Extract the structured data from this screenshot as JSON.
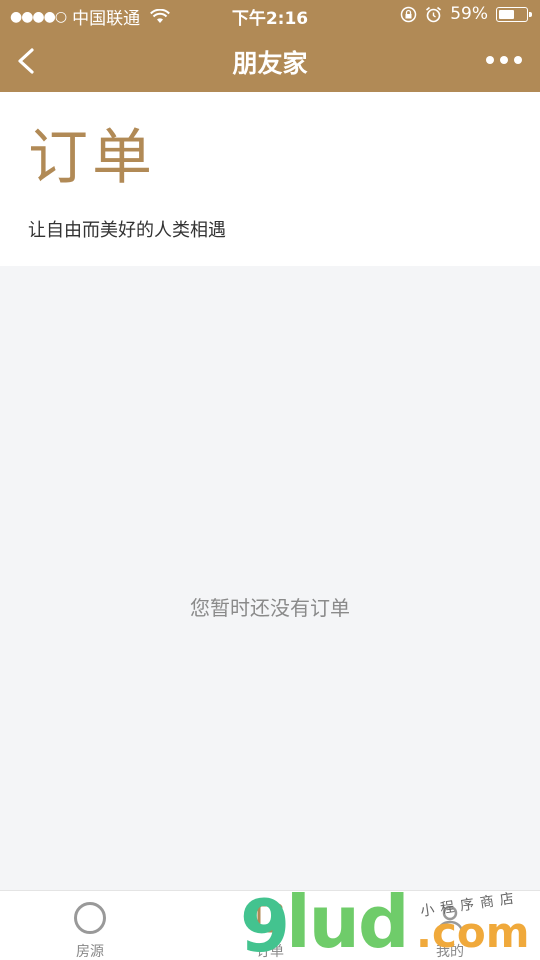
{
  "status_bar": {
    "signal_dots": "●●●●○",
    "carrier": "中国联通",
    "time": "下午2:16",
    "battery_percent": "59%",
    "battery_level": 0.59
  },
  "nav": {
    "title": "朋友家"
  },
  "page": {
    "title": "订单",
    "subtitle": "让自由而美好的人类相遇",
    "empty_message": "您暂时还没有订单"
  },
  "tabs": [
    {
      "label": "房源",
      "icon": "circle-icon"
    },
    {
      "label": "订单",
      "icon": "order-icon"
    },
    {
      "label": "我的",
      "icon": "profile-icon"
    }
  ],
  "watermark": {
    "brand_9": "9",
    "brand_lud": "lud",
    "brand_com": ".com",
    "tagline": "小程序商店"
  },
  "colors": {
    "brand": "#b18a56",
    "background": "#f4f5f7",
    "empty_text": "#8a8a8a"
  }
}
